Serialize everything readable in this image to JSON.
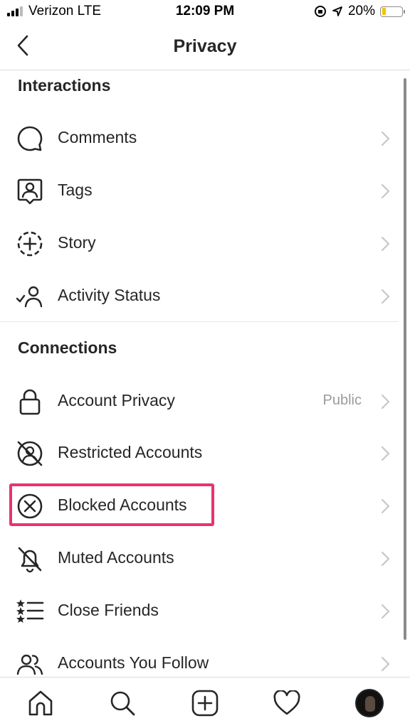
{
  "status_bar": {
    "carrier": "Verizon LTE",
    "time": "12:09 PM",
    "battery": "20%",
    "battery_level": 0.2,
    "battery_color": "#f2c500"
  },
  "header": {
    "title": "Privacy",
    "back_icon": "chevron-left-icon"
  },
  "sections": {
    "interactions": {
      "title": "Interactions",
      "items": [
        {
          "label": "Comments",
          "icon": "comment-icon"
        },
        {
          "label": "Tags",
          "icon": "tag-person-icon"
        },
        {
          "label": "Story",
          "icon": "story-add-icon"
        },
        {
          "label": "Activity Status",
          "icon": "activity-status-icon"
        }
      ]
    },
    "connections": {
      "title": "Connections",
      "items": [
        {
          "label": "Account Privacy",
          "value": "Public",
          "icon": "lock-icon"
        },
        {
          "label": "Restricted Accounts",
          "icon": "restricted-icon"
        },
        {
          "label": "Blocked Accounts",
          "icon": "blocked-icon",
          "highlighted": true
        },
        {
          "label": "Muted Accounts",
          "icon": "muted-bell-icon"
        },
        {
          "label": "Close Friends",
          "icon": "close-friends-icon"
        },
        {
          "label": "Accounts You Follow",
          "icon": "accounts-follow-icon"
        }
      ]
    }
  },
  "highlight_color": "#e8336f",
  "tab_bar": {
    "items": [
      "home-icon",
      "search-icon",
      "new-post-icon",
      "activity-heart-icon",
      "profile-avatar"
    ]
  }
}
